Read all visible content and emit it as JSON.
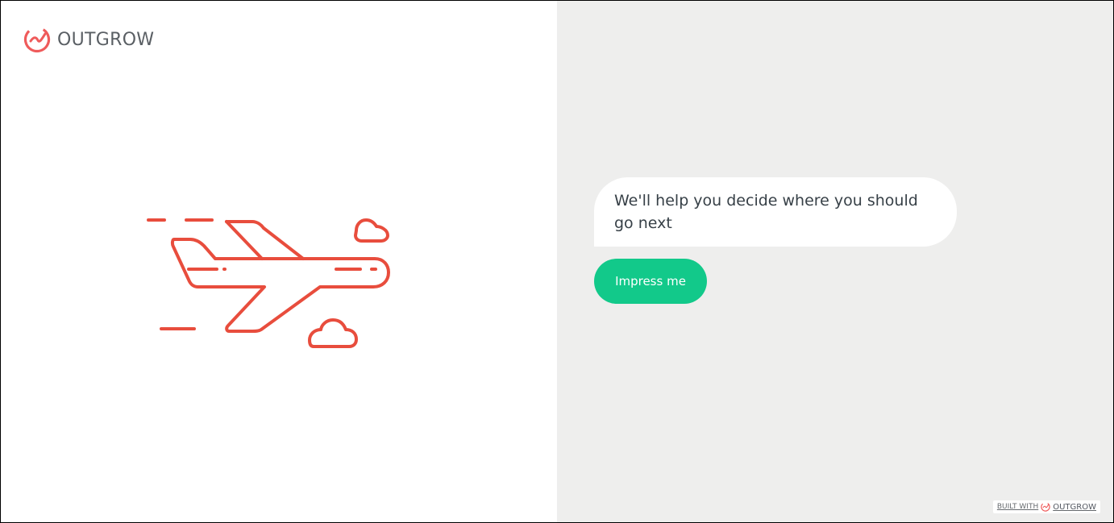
{
  "brand": {
    "name": "OUTGROW",
    "icon": "outgrow-logo-icon"
  },
  "hero": {
    "icon": "airplane-illustration"
  },
  "chat": {
    "message": "We'll help you decide where you should go next",
    "button_label": "Impress me"
  },
  "footer": {
    "built_with_label": "BUILT WITH",
    "brand": "OUTGROW",
    "icon": "outgrow-logo-icon"
  },
  "colors": {
    "accent": "#12c98a",
    "brand": "#e84d3d",
    "right_background": "#eeeeed",
    "left_background": "#ffffff",
    "text": "#374047"
  }
}
